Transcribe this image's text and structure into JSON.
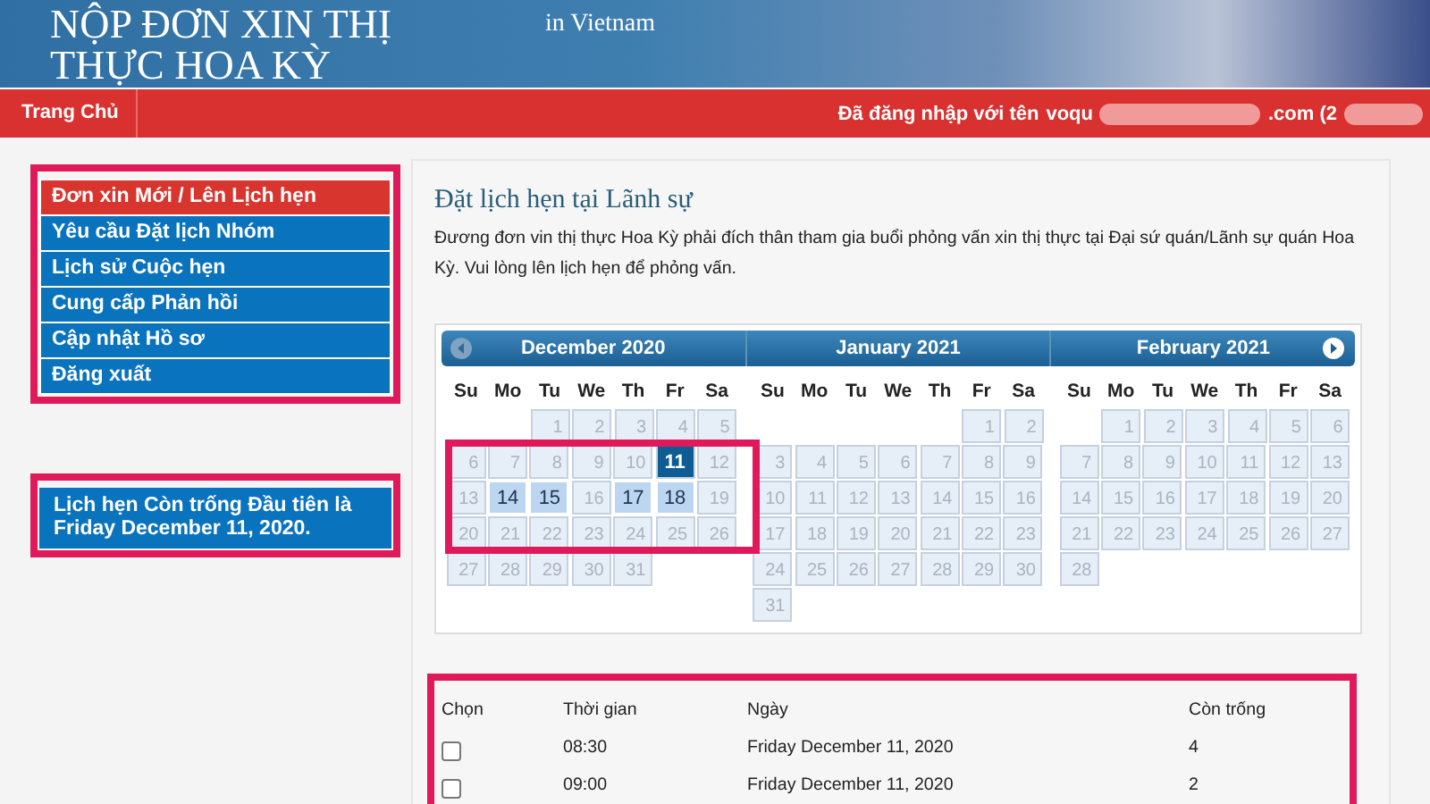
{
  "banner": {
    "title_lines": [
      "NỘP ĐƠN XIN THỊ",
      "THỰC HOA KỲ"
    ],
    "location": "in Vietnam"
  },
  "navbar": {
    "home": "Trang Chủ",
    "login_label": "Đã đăng nhập với tên",
    "account_start": "voqu",
    "account_end": ".com (2"
  },
  "sidebar": {
    "items": [
      {
        "label": "Đơn xin Mới / Lên Lịch hẹn",
        "selected": true
      },
      {
        "label": "Yêu cầu Đặt lịch Nhóm",
        "selected": false
      },
      {
        "label": "Lịch sử Cuộc hẹn",
        "selected": false
      },
      {
        "label": "Cung cấp Phản hồi",
        "selected": false
      },
      {
        "label": "Cập nhật Hồ sơ",
        "selected": false
      },
      {
        "label": "Đăng xuất",
        "selected": false
      }
    ],
    "notice": "Lịch hẹn Còn trống Đầu tiên là Friday December 11, 2020."
  },
  "main": {
    "title": "Đặt lịch hẹn tại Lãnh sự",
    "intro": "Đương đơn vin thị thực Hoa Kỳ phải đích thân tham gia buổi phỏng vấn xin thị thực tại Đại sứ quán/Lãnh sự quán Hoa Kỳ. Vui lòng lên lịch hẹn để phỏng vấn."
  },
  "calendar": {
    "months": [
      {
        "name": "December 2020",
        "prev_button": true,
        "next_button": false,
        "weekdays": [
          "Su",
          "Mo",
          "Tu",
          "We",
          "Th",
          "Fr",
          "Sa"
        ],
        "weeks": [
          {
            "kind": "leading",
            "days": [
              {
                "day": "1",
                "open": false,
                "selected": false
              },
              {
                "day": "2",
                "open": false,
                "selected": false
              },
              {
                "day": "3",
                "open": false,
                "selected": false
              },
              {
                "day": "4",
                "open": false,
                "selected": false
              },
              {
                "day": "5",
                "open": false,
                "selected": false
              }
            ]
          },
          {
            "kind": "full",
            "days": [
              {
                "day": "6",
                "open": false,
                "selected": false
              },
              {
                "day": "7",
                "open": false,
                "selected": false
              },
              {
                "day": "8",
                "open": false,
                "selected": false
              },
              {
                "day": "9",
                "open": false,
                "selected": false
              },
              {
                "day": "10",
                "open": false,
                "selected": false
              },
              {
                "day": "11",
                "open": true,
                "selected": true
              },
              {
                "day": "12",
                "open": false,
                "selected": false
              }
            ]
          },
          {
            "kind": "full",
            "days": [
              {
                "day": "13",
                "open": false,
                "selected": false
              },
              {
                "day": "14",
                "open": true,
                "selected": false
              },
              {
                "day": "15",
                "open": true,
                "selected": false
              },
              {
                "day": "16",
                "open": false,
                "selected": false
              },
              {
                "day": "17",
                "open": true,
                "selected": false
              },
              {
                "day": "18",
                "open": true,
                "selected": false
              },
              {
                "day": "19",
                "open": false,
                "selected": false
              }
            ]
          },
          {
            "kind": "full",
            "days": [
              {
                "day": "20",
                "open": false,
                "selected": false
              },
              {
                "day": "21",
                "open": false,
                "selected": false
              },
              {
                "day": "22",
                "open": false,
                "selected": false
              },
              {
                "day": "23",
                "open": false,
                "selected": false
              },
              {
                "day": "24",
                "open": false,
                "selected": false
              },
              {
                "day": "25",
                "open": false,
                "selected": false
              },
              {
                "day": "26",
                "open": false,
                "selected": false
              }
            ]
          },
          {
            "kind": "trailing",
            "days": [
              {
                "day": "27",
                "open": false,
                "selected": false
              },
              {
                "day": "28",
                "open": false,
                "selected": false
              },
              {
                "day": "29",
                "open": false,
                "selected": false
              },
              {
                "day": "30",
                "open": false,
                "selected": false
              },
              {
                "day": "31",
                "open": false,
                "selected": false
              }
            ]
          }
        ]
      },
      {
        "name": "January 2021",
        "prev_button": false,
        "next_button": false,
        "weekdays": [
          "Su",
          "Mo",
          "Tu",
          "We",
          "Th",
          "Fr",
          "Sa"
        ],
        "weeks": [
          {
            "kind": "leading",
            "days": [
              {
                "day": "1",
                "open": false,
                "selected": false
              },
              {
                "day": "2",
                "open": false,
                "selected": false
              }
            ]
          },
          {
            "kind": "full",
            "days": [
              {
                "day": "3",
                "open": false,
                "selected": false
              },
              {
                "day": "4",
                "open": false,
                "selected": false
              },
              {
                "day": "5",
                "open": false,
                "selected": false
              },
              {
                "day": "6",
                "open": false,
                "selected": false
              },
              {
                "day": "7",
                "open": false,
                "selected": false
              },
              {
                "day": "8",
                "open": false,
                "selected": false
              },
              {
                "day": "9",
                "open": false,
                "selected": false
              }
            ]
          },
          {
            "kind": "full",
            "days": [
              {
                "day": "10",
                "open": false,
                "selected": false
              },
              {
                "day": "11",
                "open": false,
                "selected": false
              },
              {
                "day": "12",
                "open": false,
                "selected": false
              },
              {
                "day": "13",
                "open": false,
                "selected": false
              },
              {
                "day": "14",
                "open": false,
                "selected": false
              },
              {
                "day": "15",
                "open": false,
                "selected": false
              },
              {
                "day": "16",
                "open": false,
                "selected": false
              }
            ]
          },
          {
            "kind": "full",
            "days": [
              {
                "day": "17",
                "open": false,
                "selected": false
              },
              {
                "day": "18",
                "open": false,
                "selected": false
              },
              {
                "day": "19",
                "open": false,
                "selected": false
              },
              {
                "day": "20",
                "open": false,
                "selected": false
              },
              {
                "day": "21",
                "open": false,
                "selected": false
              },
              {
                "day": "22",
                "open": false,
                "selected": false
              },
              {
                "day": "23",
                "open": false,
                "selected": false
              }
            ]
          },
          {
            "kind": "full",
            "days": [
              {
                "day": "24",
                "open": false,
                "selected": false
              },
              {
                "day": "25",
                "open": false,
                "selected": false
              },
              {
                "day": "26",
                "open": false,
                "selected": false
              },
              {
                "day": "27",
                "open": false,
                "selected": false
              },
              {
                "day": "28",
                "open": false,
                "selected": false
              },
              {
                "day": "29",
                "open": false,
                "selected": false
              },
              {
                "day": "30",
                "open": false,
                "selected": false
              }
            ]
          },
          {
            "kind": "trailing",
            "days": [
              {
                "day": "31",
                "open": false,
                "selected": false
              }
            ]
          }
        ]
      },
      {
        "name": "February 2021",
        "prev_button": false,
        "next_button": true,
        "weekdays": [
          "Su",
          "Mo",
          "Tu",
          "We",
          "Th",
          "Fr",
          "Sa"
        ],
        "weeks": [
          {
            "kind": "leading",
            "days": [
              {
                "day": "1",
                "open": false,
                "selected": false
              },
              {
                "day": "2",
                "open": false,
                "selected": false
              },
              {
                "day": "3",
                "open": false,
                "selected": false
              },
              {
                "day": "4",
                "open": false,
                "selected": false
              },
              {
                "day": "5",
                "open": false,
                "selected": false
              },
              {
                "day": "6",
                "open": false,
                "selected": false
              }
            ]
          },
          {
            "kind": "full",
            "days": [
              {
                "day": "7",
                "open": false,
                "selected": false
              },
              {
                "day": "8",
                "open": false,
                "selected": false
              },
              {
                "day": "9",
                "open": false,
                "selected": false
              },
              {
                "day": "10",
                "open": false,
                "selected": false
              },
              {
                "day": "11",
                "open": false,
                "selected": false
              },
              {
                "day": "12",
                "open": false,
                "selected": false
              },
              {
                "day": "13",
                "open": false,
                "selected": false
              }
            ]
          },
          {
            "kind": "full",
            "days": [
              {
                "day": "14",
                "open": false,
                "selected": false
              },
              {
                "day": "15",
                "open": false,
                "selected": false
              },
              {
                "day": "16",
                "open": false,
                "selected": false
              },
              {
                "day": "17",
                "open": false,
                "selected": false
              },
              {
                "day": "18",
                "open": false,
                "selected": false
              },
              {
                "day": "19",
                "open": false,
                "selected": false
              },
              {
                "day": "20",
                "open": false,
                "selected": false
              }
            ]
          },
          {
            "kind": "full",
            "days": [
              {
                "day": "21",
                "open": false,
                "selected": false
              },
              {
                "day": "22",
                "open": false,
                "selected": false
              },
              {
                "day": "23",
                "open": false,
                "selected": false
              },
              {
                "day": "24",
                "open": false,
                "selected": false
              },
              {
                "day": "25",
                "open": false,
                "selected": false
              },
              {
                "day": "26",
                "open": false,
                "selected": false
              },
              {
                "day": "27",
                "open": false,
                "selected": false
              }
            ]
          },
          {
            "kind": "trailing",
            "days": [
              {
                "day": "28",
                "open": false,
                "selected": false
              }
            ]
          }
        ]
      }
    ]
  },
  "slots": {
    "columns": [
      "Chọn",
      "Thời gian",
      "Ngày",
      "Còn trống"
    ],
    "rows": [
      {
        "checked": false,
        "time": "08:30",
        "date": "Friday December 11, 2020",
        "remaining": "4"
      },
      {
        "checked": false,
        "time": "09:00",
        "date": "Friday December 11, 2020",
        "remaining": "2"
      }
    ]
  }
}
